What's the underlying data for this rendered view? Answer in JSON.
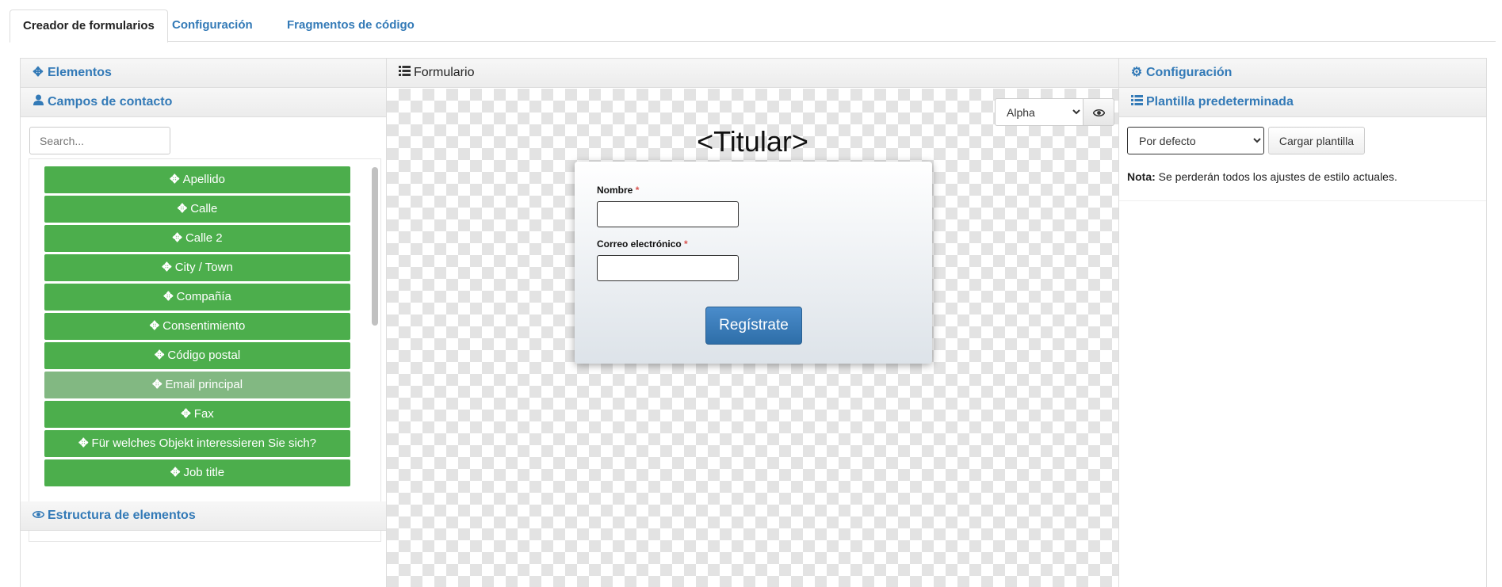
{
  "tabs": [
    "Creador de formularios",
    "Configuración",
    "Fragmentos de código"
  ],
  "left": {
    "elements_title": "Elementos",
    "contact_title": "Campos de contacto",
    "search_placeholder": "Search...",
    "items": [
      "Apellido",
      "Calle",
      "Calle 2",
      "City / Town",
      "Compañía",
      "Consentimiento",
      "Código postal",
      "Email principal",
      "Fax",
      "Für welches Objekt interessieren Sie sich?",
      "Job title"
    ],
    "structure_title": "Estructura de elementos"
  },
  "center": {
    "title": "Formulario",
    "theme_value": "Alpha",
    "headline": "<Titular>",
    "fields": [
      {
        "label": "Nombre",
        "required": "*"
      },
      {
        "label": "Correo electrónico",
        "required": "*"
      }
    ],
    "submit_label": "Regístrate"
  },
  "right": {
    "config_title": "Configuración",
    "template_title": "Plantilla predeterminada",
    "template_value": "Por defecto",
    "load_label": "Cargar plantilla",
    "note_label": "Nota:",
    "note_text": "Se perderán todos los ajustes de estilo actuales."
  },
  "icons": {
    "move": "move-icon",
    "user": "user-icon",
    "list": "list-icon",
    "eye": "eye-icon",
    "gear": "gear-icon"
  },
  "colors": {
    "link": "#337ab7",
    "item_green": "#4cae4c",
    "item_dim": "#82b882",
    "submit_blue": "#337ab7",
    "required": "#d9534f"
  }
}
